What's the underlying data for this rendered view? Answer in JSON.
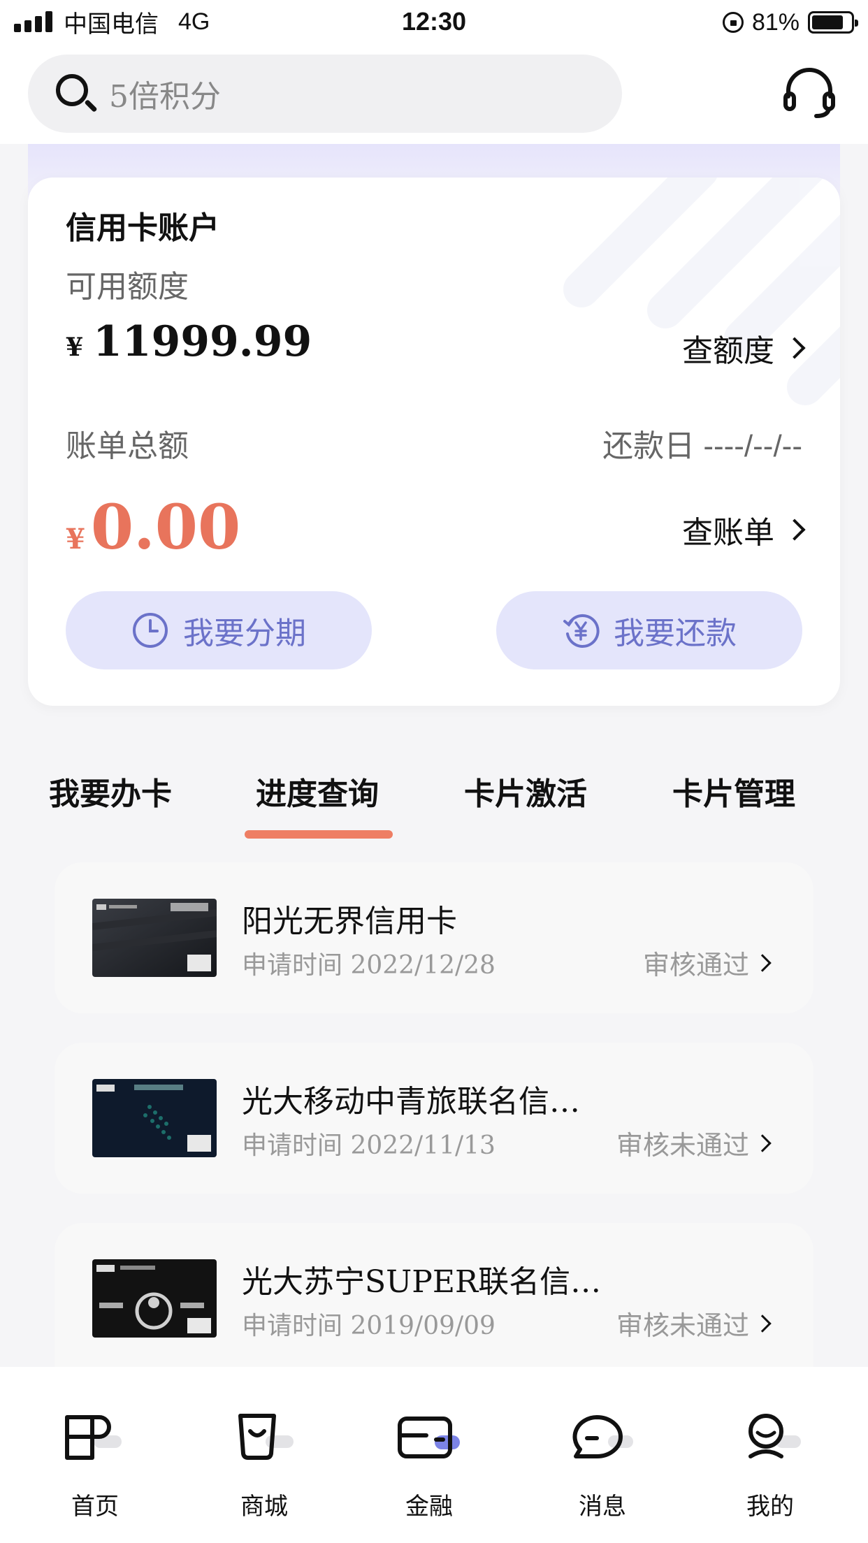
{
  "status_bar": {
    "carrier": "中国电信",
    "network": "4G",
    "time": "12:30",
    "battery_percent": "81%",
    "battery_level": 0.81
  },
  "search": {
    "placeholder": "5倍积分"
  },
  "account": {
    "title": "信用卡账户",
    "available_label": "可用额度",
    "currency_symbol": "¥",
    "available_value": "11999.99",
    "check_limit_label": "查额度",
    "bill_total_label": "账单总额",
    "due_date_label": "还款日 ----/--/--",
    "bill_value": "0.00",
    "check_bill_label": "查账单",
    "installment_button": "我要分期",
    "repay_button": "我要还款"
  },
  "tabs": [
    {
      "label": "我要办卡"
    },
    {
      "label": "进度查询"
    },
    {
      "label": "卡片激活"
    },
    {
      "label": "卡片管理"
    }
  ],
  "active_tab_index": 1,
  "applications": [
    {
      "name": "阳光无界信用卡",
      "date": "申请时间 2022/12/28",
      "status": "审核通过"
    },
    {
      "name": "光大移动中青旅联名信…",
      "date": "申请时间 2022/11/13",
      "status": "审核未通过"
    },
    {
      "name": "光大苏宁SUPER联名信…",
      "date": "申请时间 2019/09/09",
      "status": "审核未通过"
    }
  ],
  "bottom_nav": [
    {
      "label": "首页",
      "icon": "home-icon"
    },
    {
      "label": "商城",
      "icon": "shopping-bag-icon"
    },
    {
      "label": "金融",
      "icon": "wallet-card-icon"
    },
    {
      "label": "消息",
      "icon": "chat-bubble-icon"
    },
    {
      "label": "我的",
      "icon": "profile-icon"
    }
  ],
  "colors": {
    "accent": "#ee7e64",
    "amount_red": "#e8745c",
    "button_bg": "#e4e5fb",
    "button_text": "#6b72c9",
    "nav_active_dot": "#7b83e6"
  }
}
